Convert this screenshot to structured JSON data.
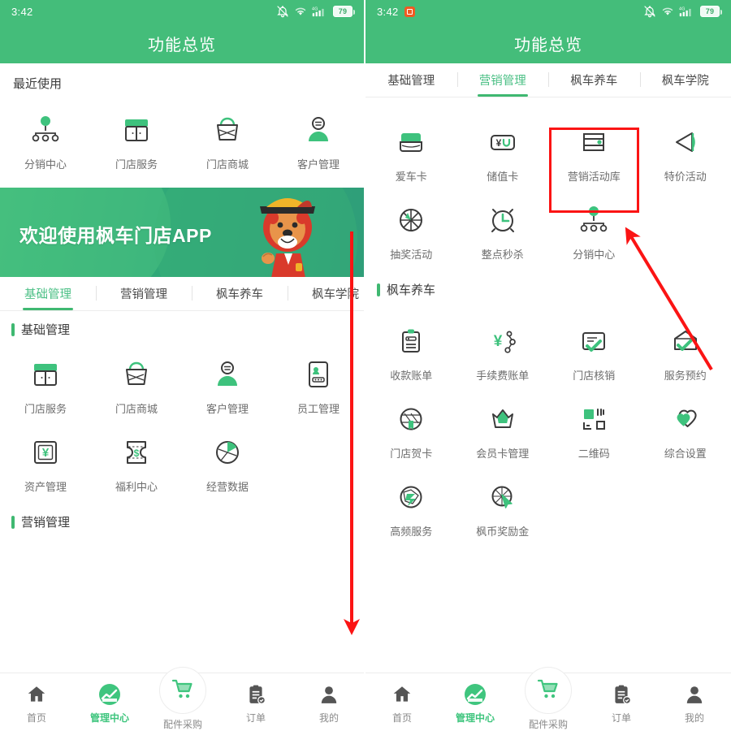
{
  "status_bar": {
    "time": "3:42",
    "battery": "79",
    "network": "4G",
    "icons": [
      "bell-muted-icon",
      "wifi-icon",
      "signal-icon",
      "battery-icon"
    ]
  },
  "header": {
    "title": "功能总览"
  },
  "accent_colors": {
    "green": "#44bd7a",
    "green_light": "#4cc086",
    "annotation_red": "#fb1414",
    "label_gray": "#6d6d6d",
    "recording_dot": "#f05a22"
  },
  "left_screen": {
    "recent_section_title": "最近使用",
    "recent_items": [
      {
        "label": "分销中心",
        "icon": "distribution-network-icon"
      },
      {
        "label": "门店服务",
        "icon": "storefront-icon"
      },
      {
        "label": "门店商城",
        "icon": "shopping-basket-icon"
      },
      {
        "label": "客户管理",
        "icon": "customer-person-icon"
      }
    ],
    "banner": {
      "text": "欢迎使用枫车门店APP",
      "mascot": "lion-mascot"
    },
    "tabs": [
      {
        "label": "基础管理",
        "active": true
      },
      {
        "label": "营销管理",
        "active": false
      },
      {
        "label": "枫车养车",
        "active": false
      },
      {
        "label": "枫车学院",
        "active": false
      }
    ],
    "sections": [
      {
        "title": "基础管理",
        "items": [
          {
            "label": "门店服务",
            "icon": "storefront-icon"
          },
          {
            "label": "门店商城",
            "icon": "shopping-basket-icon"
          },
          {
            "label": "客户管理",
            "icon": "customer-person-icon"
          },
          {
            "label": "员工管理",
            "icon": "staff-badge-icon"
          },
          {
            "label": "资产管理",
            "icon": "asset-yuan-box-icon"
          },
          {
            "label": "福利中心",
            "icon": "welfare-coupon-icon"
          },
          {
            "label": "经营数据",
            "icon": "pie-chart-icon"
          }
        ]
      },
      {
        "title": "营销管理",
        "items": []
      }
    ]
  },
  "right_screen": {
    "tabs": [
      {
        "label": "基础管理",
        "active": false
      },
      {
        "label": "营销管理",
        "active": true
      },
      {
        "label": "枫车养车",
        "active": false
      },
      {
        "label": "枫车学院",
        "active": false
      }
    ],
    "sections": [
      {
        "title": "",
        "items": [
          {
            "label": "爱车卡",
            "icon": "car-card-icon"
          },
          {
            "label": "储值卡",
            "icon": "stored-value-card-icon"
          },
          {
            "label": "营销活动库",
            "icon": "campaign-library-icon",
            "highlighted": true
          },
          {
            "label": "特价活动",
            "icon": "megaphone-icon"
          },
          {
            "label": "抽奖活动",
            "icon": "lottery-wheel-icon"
          },
          {
            "label": "整点秒杀",
            "icon": "alarm-clock-icon"
          },
          {
            "label": "分销中心",
            "icon": "distribution-network-icon"
          }
        ]
      },
      {
        "title": "枫车养车",
        "items": [
          {
            "label": "收款账单",
            "icon": "receipt-clipboard-icon"
          },
          {
            "label": "手续费账单",
            "icon": "fee-yuan-node-icon"
          },
          {
            "label": "门店核销",
            "icon": "verify-document-icon"
          },
          {
            "label": "服务预约",
            "icon": "appointment-house-check-icon"
          },
          {
            "label": "门店贺卡",
            "icon": "greeting-card-icon"
          },
          {
            "label": "会员卡管理",
            "icon": "crown-icon"
          },
          {
            "label": "二维码",
            "icon": "qrcode-icon"
          },
          {
            "label": "综合设置",
            "icon": "heart-settings-icon"
          },
          {
            "label": "高频服务",
            "icon": "high-frequency-icon"
          },
          {
            "label": "枫币奖励金",
            "icon": "coin-reward-icon"
          }
        ]
      }
    ]
  },
  "bottom_nav": [
    {
      "label": "首页",
      "icon": "home-icon",
      "active": false
    },
    {
      "label": "管理中心",
      "icon": "management-chart-icon",
      "active": true
    },
    {
      "label": "配件采购",
      "icon": "shopping-cart-icon",
      "active": false,
      "raised": true
    },
    {
      "label": "订单",
      "icon": "order-clipboard-icon",
      "active": false
    },
    {
      "label": "我的",
      "icon": "profile-person-icon",
      "active": false
    }
  ],
  "annotations": {
    "highlight_box_target": "营销活动库",
    "arrows": [
      {
        "name": "vertical-scroll-arrow",
        "direction": "down"
      },
      {
        "name": "diagonal-pointer-arrow",
        "direction": "up-left"
      }
    ]
  }
}
